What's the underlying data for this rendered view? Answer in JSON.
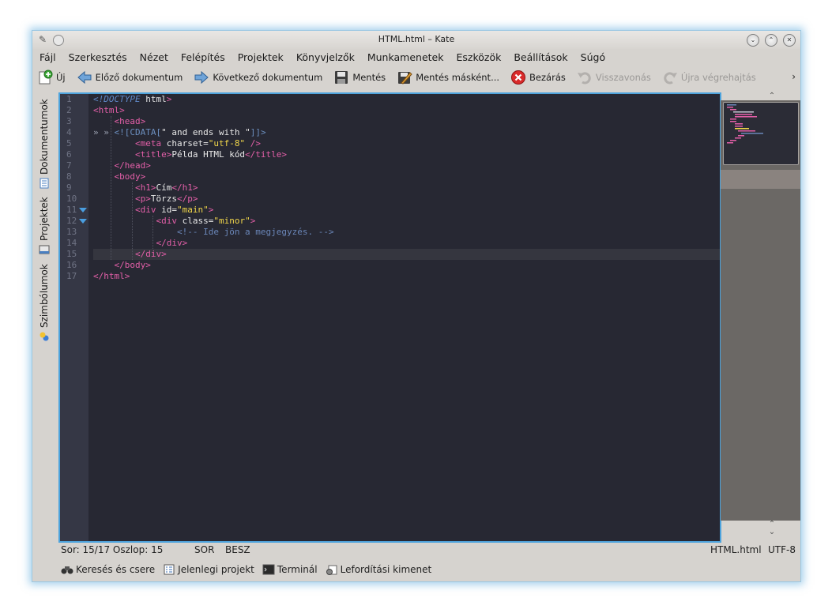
{
  "window": {
    "title": "HTML.html – Kate"
  },
  "menu": [
    "Fájl",
    "Szerkesztés",
    "Nézet",
    "Felépítés",
    "Projektek",
    "Könyvjelzők",
    "Munkamenetek",
    "Eszközök",
    "Beállítások",
    "Súgó"
  ],
  "toolbar": {
    "new": "Új",
    "prev_doc": "Előző dokumentum",
    "next_doc": "Következő dokumentum",
    "save": "Mentés",
    "save_as": "Mentés másként...",
    "close": "Bezárás",
    "undo": "Visszavonás",
    "redo": "Újra végrehajtás",
    "more": "›"
  },
  "sidetabs": {
    "documents": "Dokumentumok",
    "projects": "Projektek",
    "symbols": "Szimbólumok"
  },
  "editor": {
    "line_numbers": [
      "1",
      "2",
      "3",
      "4",
      "5",
      "6",
      "7",
      "8",
      "9",
      "10",
      "11",
      "12",
      "13",
      "14",
      "15",
      "16",
      "17"
    ],
    "current_line": 15,
    "lines": [
      [
        {
          "t": "<!DOCTYPE",
          "c": "doctype"
        },
        {
          "t": " html",
          "c": "text"
        },
        {
          "t": ">",
          "c": "tag"
        }
      ],
      [
        {
          "t": "<html>",
          "c": "tag"
        }
      ],
      [
        {
          "t": "    ",
          "c": "text"
        },
        {
          "t": "<head>",
          "c": "tag"
        }
      ],
      [
        {
          "t": "» » ",
          "c": "ws"
        },
        {
          "t": "<![CDATA[",
          "c": "cdata"
        },
        {
          "t": "\" and ends with \"",
          "c": "text"
        },
        {
          "t": "]]>",
          "c": "cdata"
        }
      ],
      [
        {
          "t": "        ",
          "c": "text"
        },
        {
          "t": "<meta",
          "c": "tag"
        },
        {
          "t": " charset=",
          "c": "text"
        },
        {
          "t": "\"utf-8\"",
          "c": "str"
        },
        {
          "t": " />",
          "c": "tag"
        }
      ],
      [
        {
          "t": "        ",
          "c": "text"
        },
        {
          "t": "<title>",
          "c": "tag"
        },
        {
          "t": "Példa HTML kód",
          "c": "text"
        },
        {
          "t": "</title>",
          "c": "tag"
        }
      ],
      [
        {
          "t": "    ",
          "c": "text"
        },
        {
          "t": "</head>",
          "c": "tag"
        }
      ],
      [
        {
          "t": "    ",
          "c": "text"
        },
        {
          "t": "<body>",
          "c": "tag"
        }
      ],
      [
        {
          "t": "        ",
          "c": "text"
        },
        {
          "t": "<h1>",
          "c": "tag"
        },
        {
          "t": "Cím",
          "c": "text"
        },
        {
          "t": "</h1>",
          "c": "tag"
        }
      ],
      [
        {
          "t": "        ",
          "c": "text"
        },
        {
          "t": "<p>",
          "c": "tag"
        },
        {
          "t": "Törzs",
          "c": "text"
        },
        {
          "t": "</p>",
          "c": "tag"
        }
      ],
      [
        {
          "t": "        ",
          "c": "text"
        },
        {
          "t": "<div",
          "c": "tag"
        },
        {
          "t": " id=",
          "c": "text"
        },
        {
          "t": "\"main\"",
          "c": "str"
        },
        {
          "t": ">",
          "c": "tag"
        }
      ],
      [
        {
          "t": "            ",
          "c": "text"
        },
        {
          "t": "<div",
          "c": "tag"
        },
        {
          "t": " class=",
          "c": "text"
        },
        {
          "t": "\"minor\"",
          "c": "str"
        },
        {
          "t": ">",
          "c": "tag"
        }
      ],
      [
        {
          "t": "                ",
          "c": "text"
        },
        {
          "t": "<!-- Ide jön a megjegyzés. -->",
          "c": "comment"
        }
      ],
      [
        {
          "t": "            ",
          "c": "text"
        },
        {
          "t": "</div>",
          "c": "tag"
        }
      ],
      [
        {
          "t": "        ",
          "c": "text"
        },
        {
          "t": "</div>",
          "c": "tag"
        }
      ],
      [
        {
          "t": "    ",
          "c": "text"
        },
        {
          "t": "</body>",
          "c": "tag"
        }
      ],
      [
        {
          "t": "</html>",
          "c": "tag"
        }
      ]
    ],
    "colors": {
      "tag": "#e35fa8",
      "text": "#e8e8e8",
      "str": "#f1d64a",
      "doctype": "#5f88c7",
      "cdata": "#6c8fbf",
      "comment": "#6a86b8",
      "ws": "#9aa0b0"
    }
  },
  "status": {
    "position": "Sor: 15/17 Oszlop: 15",
    "mode": "SOR",
    "insert": "BESZ",
    "filetype": "HTML.html",
    "encoding": "UTF-8"
  },
  "bottom": {
    "search": "Keresés és csere",
    "project": "Jelenlegi projekt",
    "terminal": "Terminál",
    "build": "Lefordítási kimenet"
  }
}
